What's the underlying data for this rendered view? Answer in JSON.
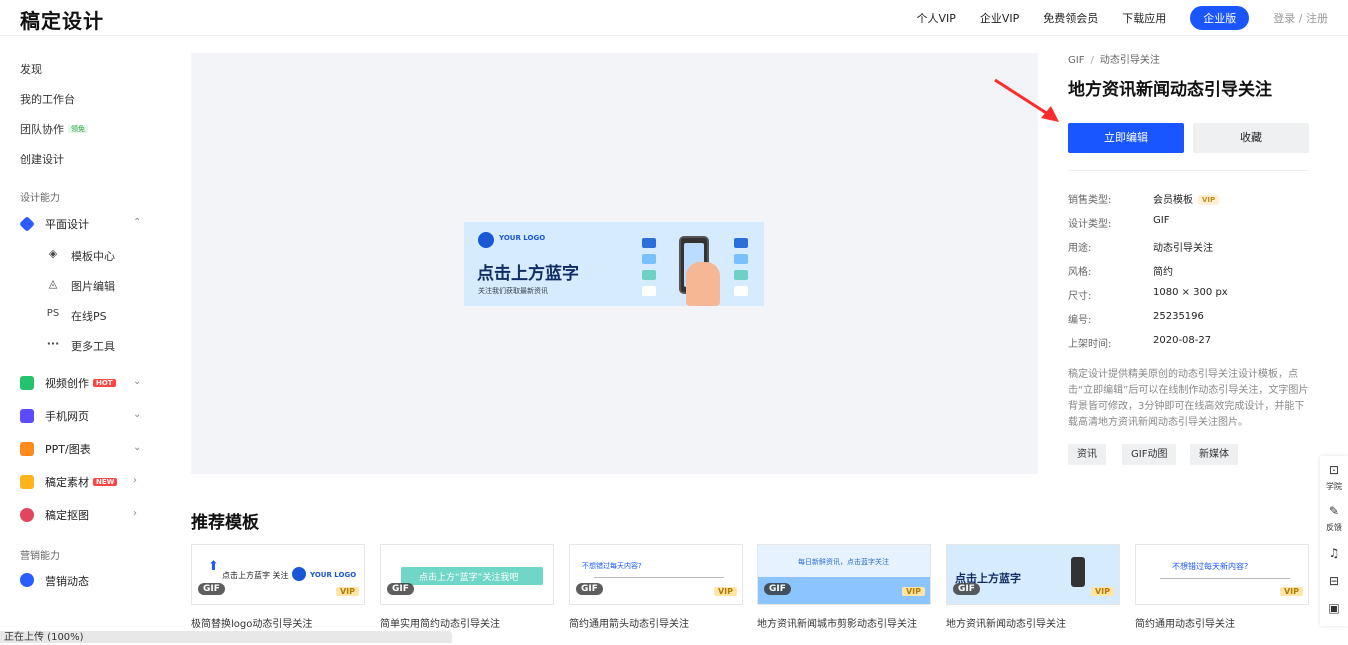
{
  "header": {
    "logo": "稿定设计",
    "nav": [
      "个人VIP",
      "企业VIP",
      "免费领会员",
      "下载应用"
    ],
    "enterprise": "企业版",
    "login": "登录 / 注册"
  },
  "sidebar": {
    "top": [
      "发现",
      "我的工作台",
      "团队协作",
      "创建设计"
    ],
    "team_badge": "领免",
    "section1": "设计能力",
    "graphic": "平面设计",
    "graphic_sub": [
      {
        "icon": "layers-icon",
        "glyph": "◈",
        "label": "模板中心"
      },
      {
        "icon": "pen-icon",
        "glyph": "◬",
        "label": "图片编辑"
      },
      {
        "icon": "ps-icon",
        "glyph": "PS",
        "label": "在线PS"
      },
      {
        "icon": "more-icon",
        "glyph": "···",
        "label": "更多工具"
      }
    ],
    "video": "视频创作",
    "video_badge": "HOT",
    "h5": "手机网页",
    "ppt": "PPT/图表",
    "material": "稿定素材",
    "material_badge": "NEW",
    "cutout": "稿定抠图",
    "section2": "营销能力",
    "marketing": "营销动态"
  },
  "banner": {
    "logo_text": "YOUR LOGO",
    "title": "点击上方蓝字",
    "subtitle": "关注我们获取最新资讯"
  },
  "detail": {
    "breadcrumb": [
      "GIF",
      "动态引导关注"
    ],
    "title": "地方资讯新闻动态引导关注",
    "edit_btn": "立即编辑",
    "fav_btn": "收藏",
    "meta": [
      {
        "k": "销售类型:",
        "v": "会员模板"
      },
      {
        "k": "设计类型:",
        "v": "GIF"
      },
      {
        "k": "用途:",
        "v": "动态引导关注"
      },
      {
        "k": "风格:",
        "v": "简约"
      },
      {
        "k": "尺寸:",
        "v": "1080 × 300 px"
      },
      {
        "k": "编号:",
        "v": "25235196"
      },
      {
        "k": "上架时间:",
        "v": "2020-08-27"
      }
    ],
    "vip_tag": "VIP",
    "description": "稿定设计提供精美原创的动态引导关注设计模板，点击“立即编辑”后可以在线制作动态引导关注，文字图片背景皆可修改，3分钟即可在线高效完成设计，并能下载高清地方资讯新闻动态引导关注图片。",
    "tags": [
      "资讯",
      "GIF动图",
      "新媒体"
    ]
  },
  "recommend": {
    "title": "推荐模板",
    "gif_label": "GIF",
    "vip_label": "VIP",
    "cards": [
      {
        "caption": "极简替换logo动态引导关注",
        "snippet": "点击上方蓝字 关注"
      },
      {
        "caption": "简单实用简约动态引导关注",
        "snippet": "点击上方“蓝字”关注我吧"
      },
      {
        "caption": "简约通用箭头动态引导关注",
        "snippet": "不想错过每天内容?"
      },
      {
        "caption": "地方资讯新闻城市剪影动态引导关注",
        "snippet": "每日新鲜资讯，点击蓝字关注"
      },
      {
        "caption": "地方资讯新闻动态引导关注",
        "snippet": "点击上方蓝字"
      },
      {
        "caption": "简约通用动态引导关注",
        "snippet": "不想错过每天新内容?"
      }
    ]
  },
  "floatbar": {
    "learn": "学院",
    "feedback": "反馈"
  },
  "upload_status": "正在上传 (100%)",
  "colors": {
    "accent": "#1a56ff",
    "hot": "#ff4444"
  }
}
